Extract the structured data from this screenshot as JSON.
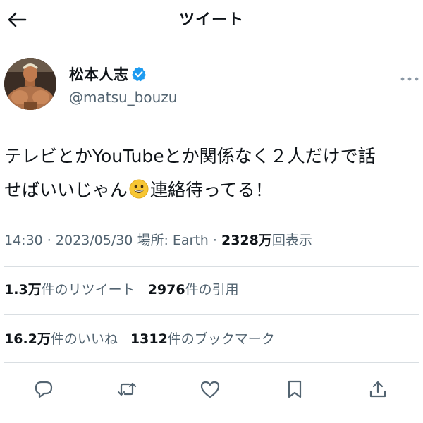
{
  "header": {
    "title": "ツイート",
    "back_icon": "arrow-left-icon"
  },
  "author": {
    "display_name": "松本人志",
    "handle": "@matsu_bouzu",
    "verified": true,
    "verified_color": "#1d9bf0"
  },
  "tweet": {
    "line1": "テレビとかYouTubeとか関係なく２人だけで話",
    "line2_before": "せばいいじゃん",
    "emoji": "smiley-face-emoji",
    "line2_after": "連絡待ってる！"
  },
  "meta": {
    "time": "14:30",
    "sep1": " · ",
    "date": "2023/05/30",
    "location_label": " 場所: Earth",
    "sep2": " · ",
    "views_count": "2328万",
    "views_label": "回表示"
  },
  "stats": {
    "retweets_count": "1.3万",
    "retweets_label": "件のリツイート",
    "quotes_count": "2976",
    "quotes_label": "件の引用",
    "likes_count": "16.2万",
    "likes_label": "件のいいね",
    "bookmarks_count": "1312",
    "bookmarks_label": "件のブックマーク"
  },
  "actions": [
    "reply-icon",
    "retweet-icon",
    "like-icon",
    "bookmark-icon",
    "share-icon"
  ],
  "colors": {
    "text": "#0f1419",
    "secondary": "#536471",
    "divider": "#d9dee2",
    "accent": "#1d9bf0"
  }
}
